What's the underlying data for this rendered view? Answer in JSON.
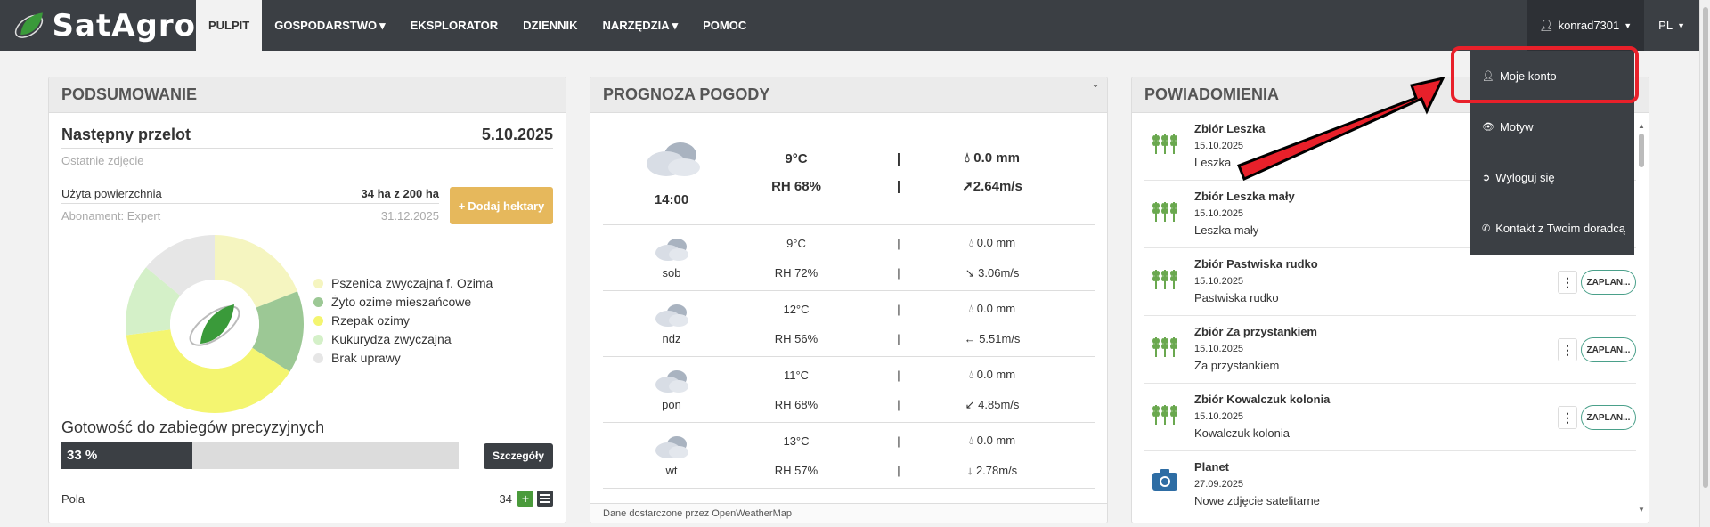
{
  "app": {
    "logo_text": "SatAgro"
  },
  "nav": {
    "items": [
      {
        "label": "PULPIT",
        "active": true,
        "has_caret": false
      },
      {
        "label": "GOSPODARSTWO",
        "active": false,
        "has_caret": true
      },
      {
        "label": "EKSPLORATOR",
        "active": false,
        "has_caret": false
      },
      {
        "label": "DZIENNIK",
        "active": false,
        "has_caret": false
      },
      {
        "label": "NARZĘDZIA",
        "active": false,
        "has_caret": true
      },
      {
        "label": "POMOC",
        "active": false,
        "has_caret": false
      }
    ],
    "user": "konrad7301",
    "lang": "PL"
  },
  "user_dropdown": {
    "items": [
      {
        "label": "Moje konto",
        "icon": "user-icon"
      },
      {
        "label": "Motyw",
        "icon": "eye-icon"
      },
      {
        "label": "Wyloguj się",
        "icon": "logout-icon"
      },
      {
        "label": "Kontakt z Twoim doradcą",
        "icon": "phone-icon"
      }
    ]
  },
  "summary": {
    "title": "PODSUMOWANIE",
    "next_pass_label": "Następny przelot",
    "next_pass_date": "5.10.2025",
    "last_photo_label": "Ostatnie zdjęcie",
    "used_area_label": "Użyta powierzchnia",
    "used_area_value": "34 ha z 200 ha",
    "subscription_label": "Abonament: Expert",
    "subscription_date": "31.12.2025",
    "add_hectares_label": "Dodaj hektary",
    "crops": [
      {
        "name": "Pszenica zwyczajna f. Ozima",
        "color": "#f5f5c0",
        "share": 0.19
      },
      {
        "name": "Żyto ozime mieszańcowe",
        "color": "#9cc895",
        "share": 0.15
      },
      {
        "name": "Rzepak ozimy",
        "color": "#f4f570",
        "share": 0.39
      },
      {
        "name": "Kukurydza zwyczajna",
        "color": "#d4f0c8",
        "share": 0.13
      },
      {
        "name": "Brak uprawy",
        "color": "#e6e6e6",
        "share": 0.14
      }
    ],
    "readiness_title": "Gotowość do zabiegów precyzyjnych",
    "readiness_percent": 33,
    "readiness_label": "33 %",
    "details_label": "Szczegóły",
    "fields_label": "Pola",
    "fields_count": "34"
  },
  "weather": {
    "title": "PROGNOZA POGODY",
    "now": {
      "time": "14:00",
      "temp": "9°C",
      "rh": "RH 68%",
      "rain": "0.0 mm",
      "wind": "2.64m/s",
      "wind_arrow": "➚"
    },
    "days": [
      {
        "day": "sob",
        "temp": "9°C",
        "rh": "RH 72%",
        "rain": "0.0 mm",
        "wind": "3.06m/s",
        "wind_arrow": "↘"
      },
      {
        "day": "ndz",
        "temp": "12°C",
        "rh": "RH 56%",
        "rain": "0.0 mm",
        "wind": "5.51m/s",
        "wind_arrow": "←"
      },
      {
        "day": "pon",
        "temp": "11°C",
        "rh": "RH 68%",
        "rain": "0.0 mm",
        "wind": "4.85m/s",
        "wind_arrow": "↙"
      },
      {
        "day": "wt",
        "temp": "13°C",
        "rh": "RH 57%",
        "rain": "0.0 mm",
        "wind": "2.78m/s",
        "wind_arrow": "↓"
      }
    ],
    "separator": "|",
    "footer": "Dane dostarczone przez OpenWeatherMap"
  },
  "notifications": {
    "title": "POWIADOMIENIA",
    "items": [
      {
        "title": "Zbiór Leszka",
        "date": "15.10.2025",
        "sub": "Leszka",
        "icon": "wheat-icon",
        "action": ""
      },
      {
        "title": "Zbiór Leszka mały",
        "date": "15.10.2025",
        "sub": "Leszka mały",
        "icon": "wheat-icon",
        "action": ""
      },
      {
        "title": "Zbiór Pastwiska rudko",
        "date": "15.10.2025",
        "sub": "Pastwiska rudko",
        "icon": "wheat-icon",
        "action": "ZAPLAN..."
      },
      {
        "title": "Zbiór Za przystankiem",
        "date": "15.10.2025",
        "sub": "Za przystankiem",
        "icon": "wheat-icon",
        "action": "ZAPLAN..."
      },
      {
        "title": "Zbiór Kowalczuk kolonia",
        "date": "15.10.2025",
        "sub": "Kowalczuk kolonia",
        "icon": "wheat-icon",
        "action": "ZAPLAN..."
      },
      {
        "title": "Planet",
        "date": "27.09.2025",
        "sub": "Nowe zdjęcie satelitarne",
        "icon": "camera-icon",
        "action": ""
      }
    ]
  },
  "colors": {
    "navbar": "#3b3f44",
    "accent_green": "#4a9a3b",
    "highlight_red": "#e8202a",
    "add_button": "#e6b85c"
  }
}
